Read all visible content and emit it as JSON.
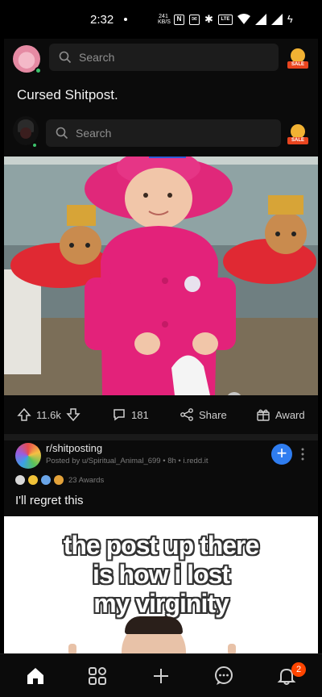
{
  "status_bar": {
    "time": "2:32",
    "network_speed": "241\nKB/S",
    "icons": [
      "nfc-icon",
      "notification-icon",
      "bluetooth-icon",
      "volte-icon",
      "wifi-icon",
      "signal-icon",
      "signal-icon",
      "charging-icon"
    ]
  },
  "header": {
    "search_placeholder": "Search",
    "sale_label": "SALE"
  },
  "post1": {
    "title": "Cursed Shitpost.",
    "inner_search_placeholder": "Search",
    "inner_sale_label": "SALE",
    "upvotes": "11.6k",
    "comments": "181",
    "share_label": "Share",
    "award_label": "Award"
  },
  "post2": {
    "subreddit": "r/shitposting",
    "meta": "Posted by u/Spiritual_Animal_699 • 8h • i.redd.it",
    "awards_count": "23 Awards",
    "title": "I'll regret this",
    "meme_lines": [
      "the post up there",
      "is how i lost",
      "my virginity"
    ]
  },
  "bottom_nav": {
    "items": [
      "home-icon",
      "communities-icon",
      "create-icon",
      "chat-icon",
      "inbox-icon"
    ],
    "inbox_badge": "2"
  },
  "colors": {
    "accent_blue": "#2f7df0",
    "orange_badge": "#ff4500",
    "background": "#0b0b0b"
  }
}
